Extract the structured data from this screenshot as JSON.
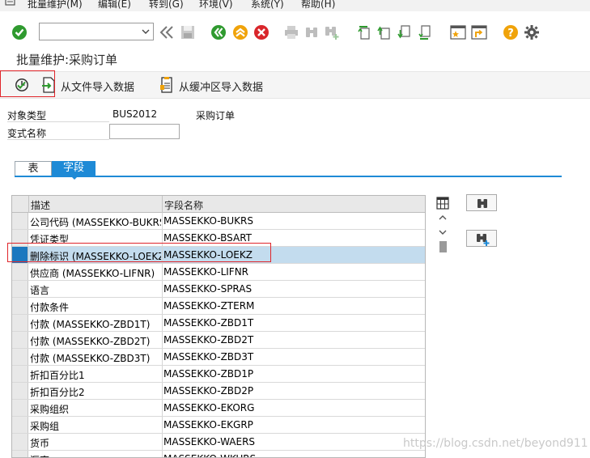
{
  "menu": {
    "items": [
      "批量维护(M)",
      "编辑(E)",
      "转到(G)",
      "环境(V)",
      "系统(Y)",
      "帮助(H)"
    ]
  },
  "toolbar": {
    "command_value": ""
  },
  "title": "批量维护:采购订单",
  "app_toolbar": {
    "import_file_label": "从文件导入数据",
    "import_buffer_label": "从缓冲区导入数据"
  },
  "header": {
    "object_type_label": "对象类型",
    "object_type_value": "BUS2012",
    "object_type_desc": "采购订单",
    "variant_label": "变式名称",
    "variant_value": ""
  },
  "tabs": [
    {
      "label": "表",
      "active": false
    },
    {
      "label": "字段",
      "active": true
    }
  ],
  "grid": {
    "columns": [
      "描述",
      "字段名称"
    ],
    "selected_index": 2,
    "rows": [
      {
        "desc": "公司代码 (MASSEKKO-BUKRS",
        "field": "MASSEKKO-BUKRS"
      },
      {
        "desc": "凭证类型",
        "field": "MASSEKKO-BSART"
      },
      {
        "desc": "删除标识 (MASSEKKO-LOEKZ",
        "field": "MASSEKKO-LOEKZ"
      },
      {
        "desc": "供应商 (MASSEKKO-LIFNR)",
        "field": "MASSEKKO-LIFNR"
      },
      {
        "desc": "语言",
        "field": "MASSEKKO-SPRAS"
      },
      {
        "desc": "付款条件",
        "field": "MASSEKKO-ZTERM"
      },
      {
        "desc": "付款 (MASSEKKO-ZBD1T)",
        "field": "MASSEKKO-ZBD1T"
      },
      {
        "desc": "付款 (MASSEKKO-ZBD2T)",
        "field": "MASSEKKO-ZBD2T"
      },
      {
        "desc": "付款 (MASSEKKO-ZBD3T)",
        "field": "MASSEKKO-ZBD3T"
      },
      {
        "desc": "折扣百分比1",
        "field": "MASSEKKO-ZBD1P"
      },
      {
        "desc": "折扣百分比2",
        "field": "MASSEKKO-ZBD2P"
      },
      {
        "desc": "采购组织",
        "field": "MASSEKKO-EKORG"
      },
      {
        "desc": "采购组",
        "field": "MASSEKKO-EKGRP"
      },
      {
        "desc": "货币",
        "field": "MASSEKKO-WAERS"
      },
      {
        "desc": "汇率",
        "field": "MASSEKKO-WKURS"
      }
    ]
  },
  "watermark": "https://blog.csdn.net/beyond911",
  "colors": {
    "accent_blue": "#1e8ad6",
    "selected_row": "#c3dcee",
    "highlight_red": "#e0252a",
    "ok_green": "#2f9a2f",
    "help_orange": "#f0a30a"
  }
}
